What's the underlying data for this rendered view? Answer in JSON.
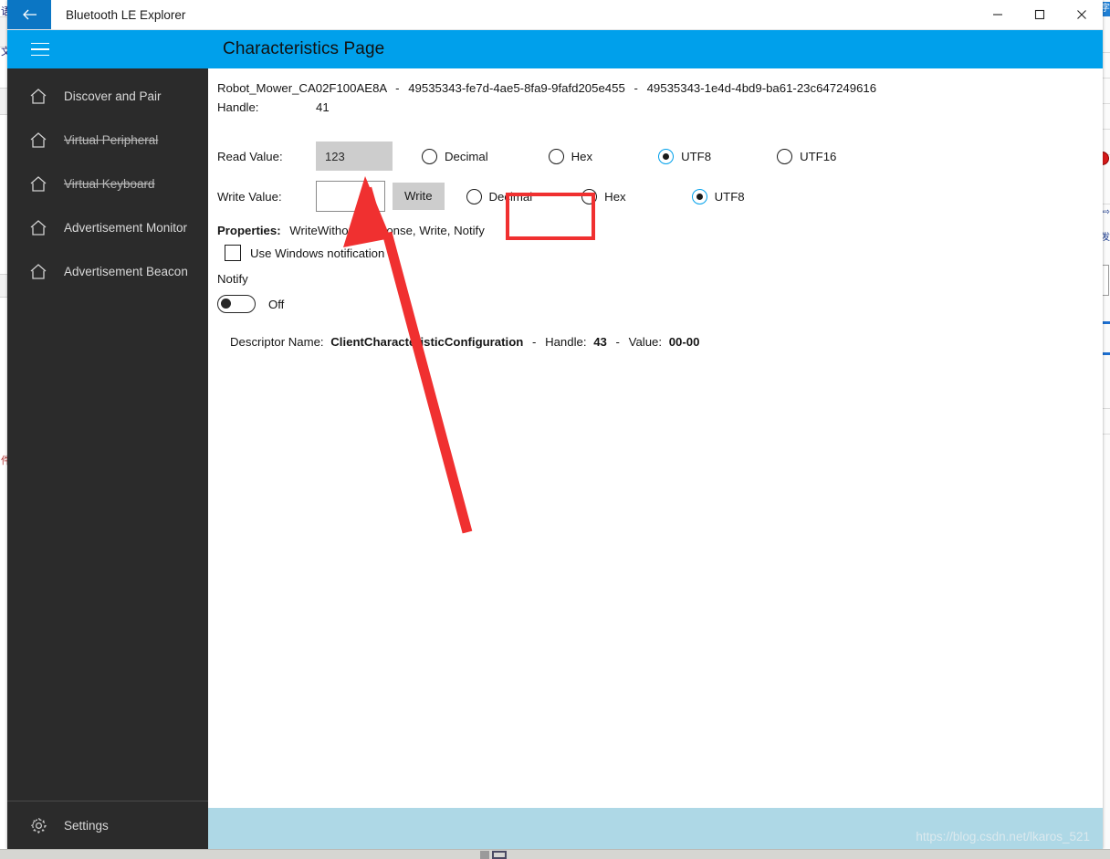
{
  "window": {
    "title": "Bluetooth LE Explorer",
    "back_icon": "back-arrow-icon",
    "minimize_label": "Minimize",
    "maximize_label": "Maximize",
    "close_label": "Close"
  },
  "commandbar": {
    "menu_icon": "hamburger-menu-icon",
    "page_title": "Characteristics Page",
    "accent_color": "#00a0eb"
  },
  "sidebar": {
    "background_color": "#2b2b2b",
    "items": [
      {
        "label": "Discover and Pair",
        "icon": "home-icon",
        "disabled": false
      },
      {
        "label": "Virtual Peripheral",
        "icon": "home-icon",
        "disabled": true
      },
      {
        "label": "Virtual Keyboard",
        "icon": "home-icon",
        "disabled": true
      },
      {
        "label": "Advertisement Monitor",
        "icon": "home-icon",
        "disabled": false
      },
      {
        "label": "Advertisement Beacon",
        "icon": "home-icon",
        "disabled": false
      }
    ],
    "settings": {
      "label": "Settings",
      "icon": "gear-icon"
    }
  },
  "main": {
    "device_name": "Robot_Mower_CA02F100AE8A",
    "separator": "-",
    "service_uuid": "49535343-fe7d-4ae5-8fa9-9fafd205e455",
    "characteristic_uuid": "49535343-1e4d-4bd9-ba61-23c647249616",
    "handle_label": "Handle:",
    "handle_value": "41",
    "read": {
      "label": "Read Value:",
      "value": "123",
      "formats": [
        {
          "label": "Decimal",
          "selected": false
        },
        {
          "label": "Hex",
          "selected": false
        },
        {
          "label": "UTF8",
          "selected": true
        },
        {
          "label": "UTF16",
          "selected": false
        }
      ]
    },
    "write": {
      "label": "Write Value:",
      "value": "",
      "placeholder": "",
      "button_label": "Write",
      "formats": [
        {
          "label": "Decimal",
          "selected": false
        },
        {
          "label": "Hex",
          "selected": false
        },
        {
          "label": "UTF8",
          "selected": true
        }
      ]
    },
    "properties": {
      "label": "Properties:",
      "value": "WriteWithoutResponse, Write, Notify"
    },
    "windows_notification": {
      "label": "Use Windows notification",
      "checked": false
    },
    "notify": {
      "label": "Notify",
      "state": "Off",
      "on": false
    },
    "descriptor": {
      "name_label": "Descriptor Name:",
      "name_value": "ClientCharacteristicConfiguration",
      "dash": "-",
      "handle_label": "Handle:",
      "handle_value": "43",
      "dash2": "-",
      "value_label": "Value:",
      "value_value": "00-00"
    }
  },
  "footer": {
    "background_color": "#aed8e6",
    "watermark": "https://blog.csdn.net/lkaros_521"
  },
  "annotations": {
    "highlight_color": "#f03030",
    "highlight_target": "read-value-field",
    "arrow_icon": "annotation-arrow-icon"
  }
}
